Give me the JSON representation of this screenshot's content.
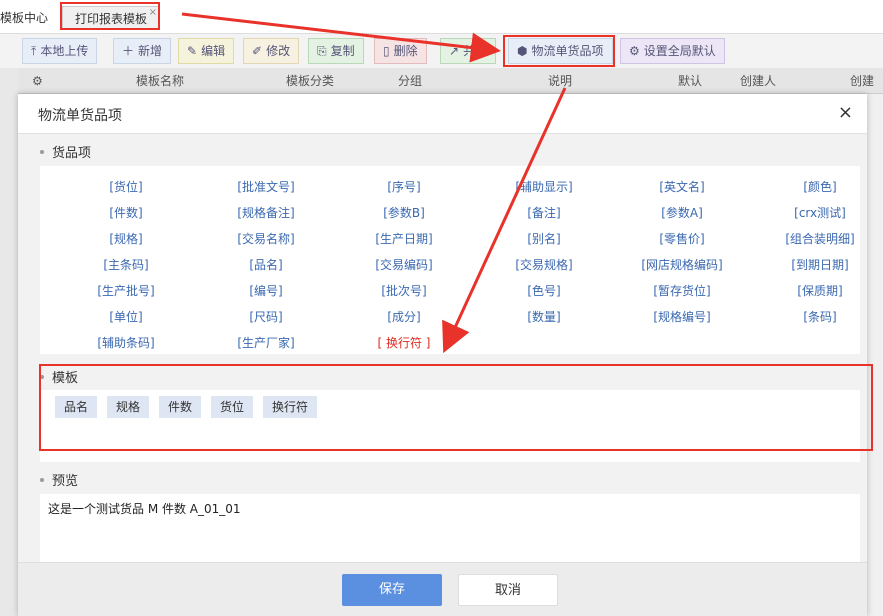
{
  "tabs": {
    "home": "模板中心",
    "active": "打印报表模板",
    "close": "×"
  },
  "toolbar": {
    "upload": "本地上传",
    "add": "新增",
    "edit": "编辑",
    "modify": "修改",
    "copy": "复制",
    "delete": "删除",
    "share": "共享",
    "cargo": "物流单货品项",
    "global": "设置全局默认"
  },
  "table": {
    "headers": [
      "模板名称",
      "模板分类",
      "分组",
      "说明",
      "默认",
      "创建人",
      "创建时"
    ]
  },
  "modal": {
    "title": "物流单货品项",
    "close": "×",
    "goods_label": "货品项",
    "fields": [
      [
        "[货位]",
        "[批准文号]",
        "[序号]",
        "[辅助显示]",
        "[英文名]",
        "[颜色]"
      ],
      [
        "[件数]",
        "[规格备注]",
        "[参数B]",
        "[备注]",
        "[参数A]",
        "[crx测试]"
      ],
      [
        "[规格]",
        "[交易名称]",
        "[生产日期]",
        "[别名]",
        "[零售价]",
        "[组合装明细]"
      ],
      [
        "[主条码]",
        "[品名]",
        "[交易编码]",
        "[交易规格]",
        "[网店规格编码]",
        "[到期日期]"
      ],
      [
        "[生产批号]",
        "[编号]",
        "[批次号]",
        "[色号]",
        "[暂存货位]",
        "[保质期]"
      ],
      [
        "[单位]",
        "[尺码]",
        "[成分]",
        "[数量]",
        "[规格编号]",
        "[条码]"
      ],
      [
        "[辅助条码]",
        "[生产厂家]",
        "[ 换行符 ]"
      ]
    ],
    "template_label": "模板",
    "template_chips": [
      "品名",
      "规格",
      "件数",
      "货位",
      "换行符"
    ],
    "preview_label": "预览",
    "preview_text": "这是一个测试货品 M 件数 A_01_01",
    "save": "保存",
    "cancel": "取消"
  },
  "colors": {
    "accent": "#5b8fe0",
    "link": "#3a68b0",
    "highlight": "#e8322a"
  }
}
